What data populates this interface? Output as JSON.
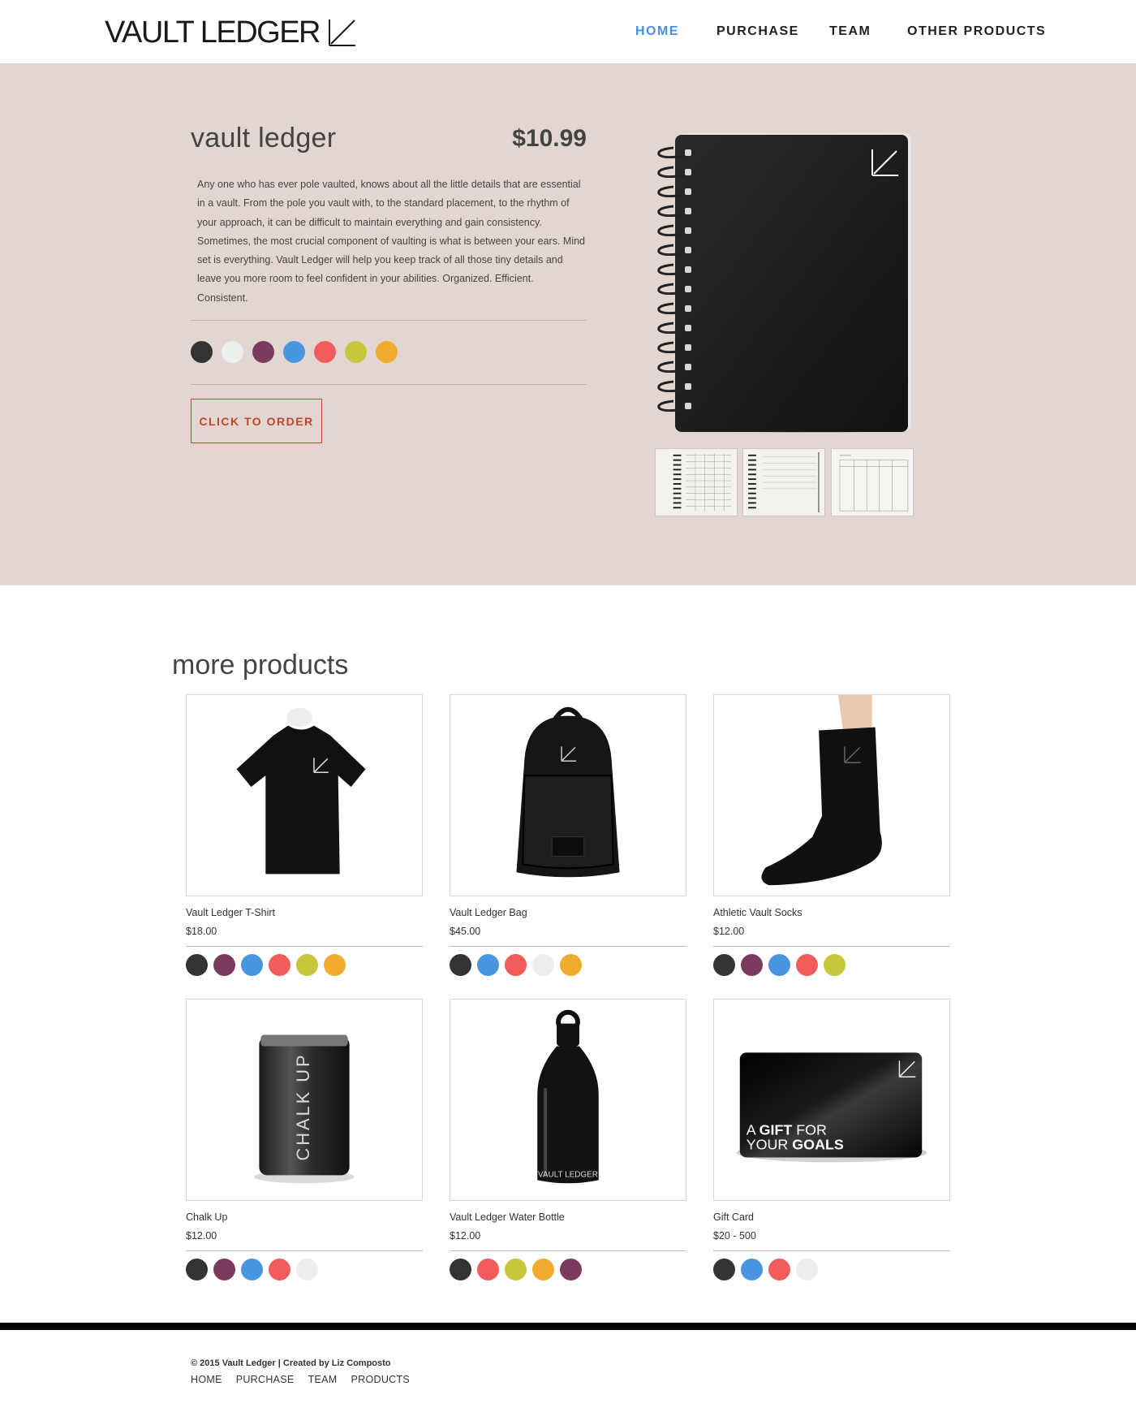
{
  "brand": {
    "name": "VAULT LEDGER"
  },
  "nav": [
    {
      "label": "HOME",
      "active": true
    },
    {
      "label": "PURCHASE",
      "active": false
    },
    {
      "label": "TEAM",
      "active": false
    },
    {
      "label": "OTHER PRODUCTS",
      "active": false
    }
  ],
  "hero": {
    "title": "vault ledger",
    "price": "$10.99",
    "description": "Any one who has ever pole vaulted, knows about all the little details that are essential in a vault. From the pole you vault with, to the standard placement, to the rhythm of your approach, it can be difficult to maintain everything and gain consistency. Sometimes, the most crucial component of vaulting is what is between your ears. Mind set is everything. Vault Ledger will help you keep track of all those tiny details and leave you more room to feel confident in your abilities. Organized. Efficient. Consistent.",
    "colors": [
      "#333333",
      "#eeeeee",
      "#7b3a5e",
      "#4a95e0",
      "#f15b5b",
      "#c8c63c",
      "#f0ac2e"
    ],
    "order_label": "CLICK TO ORDER",
    "background": "#e1d7d0"
  },
  "more": {
    "title": "more products",
    "products": [
      {
        "name": "Vault Ledger T-Shirt",
        "price": "$18.00",
        "image": "tshirt",
        "colors": [
          "#333333",
          "#7b3a5e",
          "#4a95e0",
          "#f15b5b",
          "#c8c63c",
          "#f0ac2e"
        ]
      },
      {
        "name": "Vault Ledger Bag",
        "price": "$45.00",
        "image": "backpack",
        "colors": [
          "#333333",
          "#4a95e0",
          "#f15b5b",
          "#eeeeee",
          "#f0ac2e"
        ]
      },
      {
        "name": "Athletic Vault Socks",
        "price": "$12.00",
        "image": "sock",
        "colors": [
          "#333333",
          "#7b3a5e",
          "#4a95e0",
          "#f15b5b",
          "#c8c63c"
        ]
      },
      {
        "name": "Chalk Up",
        "price": "$12.00",
        "image": "chalk-can",
        "label": "CHALK UP",
        "colors": [
          "#333333",
          "#7b3a5e",
          "#4a95e0",
          "#f15b5b",
          "#eeeeee"
        ]
      },
      {
        "name": "Vault Ledger Water Bottle",
        "price": "$12.00",
        "image": "water-bottle",
        "label": "VAULT LEDGER",
        "colors": [
          "#333333",
          "#f15b5b",
          "#c8c63c",
          "#f0ac2e",
          "#7b3a5e"
        ]
      },
      {
        "name": "Gift Card",
        "price": "$20 - 500",
        "image": "gift-card",
        "label_a": "A ",
        "label_b": "GIFT",
        "label_c": " FOR",
        "label_d": "YOUR ",
        "label_e": "GOALS",
        "colors": [
          "#333333",
          "#4a95e0",
          "#f15b5b",
          "#eeeeee"
        ]
      }
    ]
  },
  "footer": {
    "copyright": "© 2015 Vault Ledger | Created by Liz Composto",
    "links": [
      "HOME",
      "PURCHASE",
      "TEAM",
      "PRODUCTS"
    ]
  },
  "accent": "#4a8fdc",
  "button_color": "#c5432b"
}
